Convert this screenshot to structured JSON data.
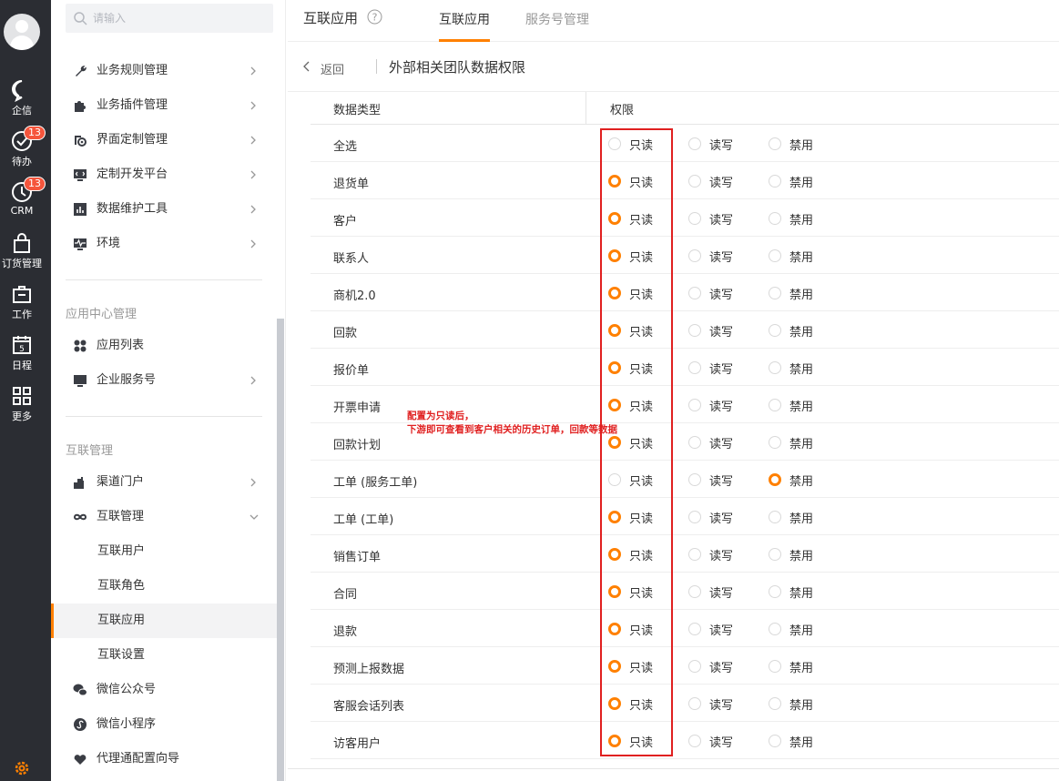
{
  "leftnav": {
    "items": [
      {
        "label": "企信",
        "icon": "chat-bubble-icon"
      },
      {
        "label": "待办",
        "icon": "check-circle-icon",
        "badge": "13"
      },
      {
        "label": "CRM",
        "icon": "clock-icon",
        "badge": "13"
      },
      {
        "label": "订货管理",
        "icon": "shopping-bag-icon"
      },
      {
        "label": "工作",
        "icon": "briefcase-icon"
      },
      {
        "label": "日程",
        "icon": "calendar-icon",
        "calendar_day": "5"
      },
      {
        "label": "更多",
        "icon": "grid-icon"
      }
    ],
    "accent": "#ff8000"
  },
  "search": {
    "placeholder": "请输入"
  },
  "sidebar": {
    "top_items": [
      {
        "label": "业务规则管理",
        "icon": "wrench-icon"
      },
      {
        "label": "业务插件管理",
        "icon": "puzzle-icon"
      },
      {
        "label": "界面定制管理",
        "icon": "palette-icon"
      },
      {
        "label": "定制开发平台",
        "icon": "code-monitor-icon"
      },
      {
        "label": "数据维护工具",
        "icon": "bar-chart-icon"
      },
      {
        "label": "环境",
        "icon": "pulse-icon"
      }
    ],
    "section_app_center": "应用中心管理",
    "app_items": [
      {
        "label": "应用列表",
        "icon": "apps-icon"
      },
      {
        "label": "企业服务号",
        "icon": "monitor-icon"
      }
    ],
    "section_interconnect": "互联管理",
    "inter_items": [
      {
        "label": "渠道门户",
        "icon": "building-icon"
      },
      {
        "label": "互联管理",
        "icon": "infinity-icon"
      }
    ],
    "sub_items": [
      {
        "label": "互联用户"
      },
      {
        "label": "互联角色"
      },
      {
        "label": "互联应用",
        "active": true
      },
      {
        "label": "互联设置"
      }
    ],
    "bottom_items": [
      {
        "label": "微信公众号",
        "icon": "wechat-icon"
      },
      {
        "label": "微信小程序",
        "icon": "mini-program-icon"
      },
      {
        "label": "代理通配置向导",
        "icon": "heart-hands-icon"
      }
    ]
  },
  "header": {
    "title": "互联应用",
    "tabs": [
      {
        "label": "互联应用",
        "active": true
      },
      {
        "label": "服务号管理",
        "active": false
      }
    ]
  },
  "backbar": {
    "back_label": "返回",
    "page_title": "外部相关团队数据权限"
  },
  "table": {
    "col_type": "数据类型",
    "col_perm": "权限",
    "options": [
      "只读",
      "读写",
      "禁用"
    ],
    "rows": [
      {
        "name": "全选",
        "selected": null
      },
      {
        "name": "退货单",
        "selected": 0
      },
      {
        "name": "客户",
        "selected": 0
      },
      {
        "name": "联系人",
        "selected": 0
      },
      {
        "name": "商机2.0",
        "selected": 0
      },
      {
        "name": "回款",
        "selected": 0
      },
      {
        "name": "报价单",
        "selected": 0
      },
      {
        "name": "开票申请",
        "selected": 0
      },
      {
        "name": "回款计划",
        "selected": 0
      },
      {
        "name": "工单 (服务工单)",
        "selected": 2
      },
      {
        "name": "工单 (工单)",
        "selected": 0
      },
      {
        "name": "销售订单",
        "selected": 0
      },
      {
        "name": "合同",
        "selected": 0
      },
      {
        "name": "退款",
        "selected": 0
      },
      {
        "name": "预测上报数据",
        "selected": 0
      },
      {
        "name": "客服会话列表",
        "selected": 0
      },
      {
        "name": "访客用户",
        "selected": 0
      }
    ]
  },
  "annotation": {
    "line1": "配置为只读后，",
    "line2": "下游即可查看到客户相关的历史订单，回款等数据",
    "color": "#e02020"
  }
}
